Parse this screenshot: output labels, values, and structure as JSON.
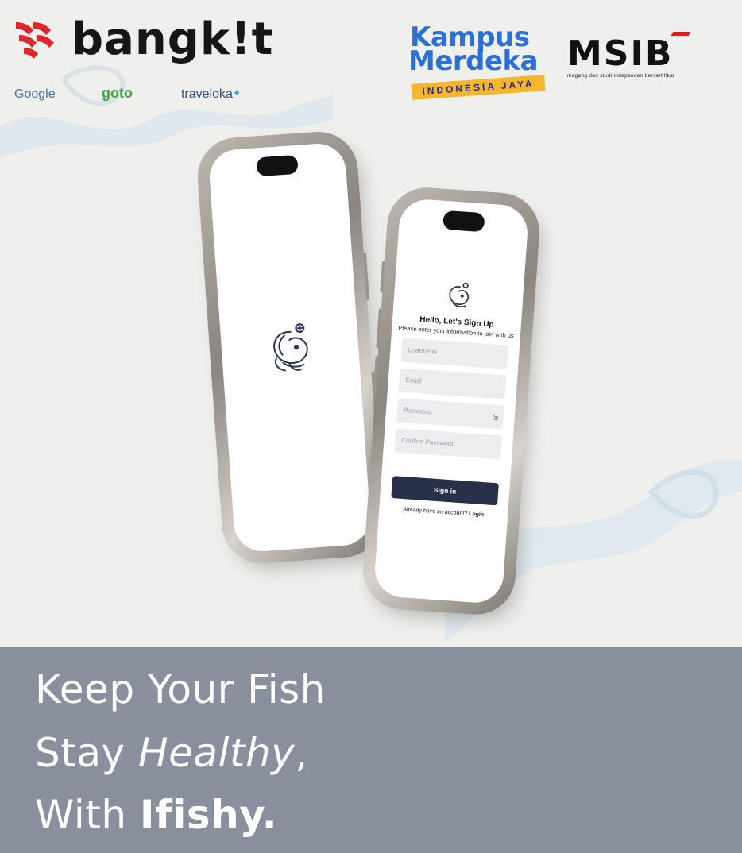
{
  "brand": {
    "bangkit": "bangk!t",
    "partners": [
      "Google",
      "goto",
      "traveloka"
    ],
    "kampus_line1": "Kampus",
    "kampus_line2": "Merdeka",
    "kampus_banner": "INDONESIA JAYA",
    "msib": "MSIB",
    "msib_sub": "magang dan studi independen bersertifikat"
  },
  "signup": {
    "title": "Hello, Let's Sign Up",
    "subtitle": "Please enter your information to join with us",
    "fields": [
      "Username",
      "Email",
      "Password",
      "Confirm Password"
    ],
    "button": "Sign in",
    "already_prefix": "Already have an account? ",
    "login": "Login"
  },
  "tagline": {
    "line1": "Keep Your Fish",
    "line2_prefix": "Stay ",
    "line2_italic": "Healthy",
    "line2_suffix": ",",
    "line3_prefix": "With ",
    "line3_bold": "Ifishy."
  },
  "colors": {
    "accent_dark": "#28304a",
    "banner_bg": "#8a8f9e",
    "bangkit_red": "#e0262d"
  }
}
